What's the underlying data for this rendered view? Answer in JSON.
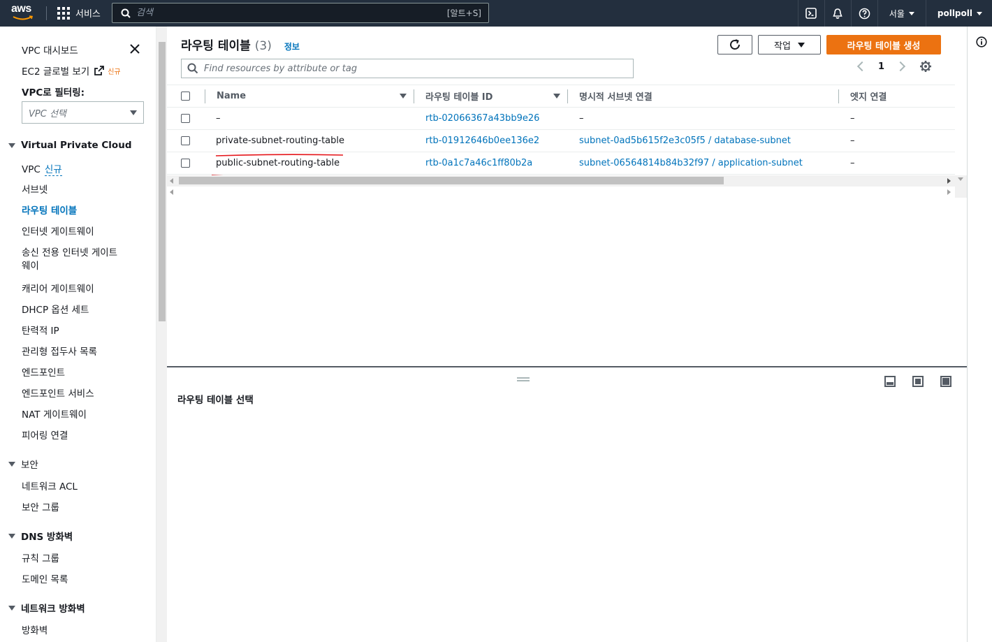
{
  "topbar": {
    "logo_text": "aws",
    "services_label": "서비스",
    "search_placeholder": "검색",
    "search_shortcut": "[알트+S]",
    "region": "서울",
    "user": "pollpoll"
  },
  "sidebar": {
    "dashboard": "VPC 대시보드",
    "global_view": "EC2 글로벌 보기",
    "new_badge": "신규",
    "filter_label": "VPC로 필터링:",
    "vpc_select_placeholder": "VPC 선택",
    "sections": [
      {
        "title": "Virtual Private Cloud",
        "items": [
          "VPC",
          "서브넷",
          "라우팅 테이블",
          "인터넷 게이트웨이",
          "송신 전용 인터넷 게이트",
          "웨이",
          "캐리어 게이트웨이",
          "DHCP 옵션 세트",
          "탄력적 IP",
          "관리형 접두사 목록",
          "엔드포인트",
          "엔드포인트 서비스",
          "NAT 게이트웨이",
          "피어링 연결"
        ]
      },
      {
        "title": "보안",
        "items": [
          "네트워크 ACL",
          "보안 그룹"
        ]
      },
      {
        "title": "DNS 방화벽",
        "items": [
          "규칙 그룹",
          "도메인 목록"
        ]
      },
      {
        "title": "네트워크 방화벽",
        "items": [
          "방화벽"
        ]
      }
    ],
    "vpc_new_tag": "신규",
    "active_item": "라우팅 테이블"
  },
  "main": {
    "title": "라우팅 테이블",
    "count": "(3)",
    "info_link": "정보",
    "actions_label": "작업",
    "create_label": "라우팅 테이블 생성",
    "filter_placeholder": "Find resources by attribute or tag",
    "page_number": "1",
    "columns": [
      "Name",
      "라우팅 테이블 ID",
      "명시적 서브넷 연결",
      "엣지 연결"
    ],
    "rows": [
      {
        "name": "–",
        "id": "rtb-02066367a43bb9e26",
        "subnet": "–",
        "edge": "–"
      },
      {
        "name": "private-subnet-routing-table",
        "id": "rtb-01912646b0ee136e2",
        "subnet": "subnet-0ad5b615f2e3c05f5 / database-subnet",
        "edge": "–"
      },
      {
        "name": "public-subnet-routing-table",
        "id": "rtb-0a1c7a46c1ff80b2a",
        "subnet": "subnet-06564814b84b32f97 / application-subnet",
        "edge": "–"
      }
    ],
    "detail_title": "라우팅 테이블 선택"
  },
  "colors": {
    "primary": "#ec7211",
    "link": "#0073bb",
    "nav_bg": "#232f3e",
    "underline": "#e5161b"
  }
}
